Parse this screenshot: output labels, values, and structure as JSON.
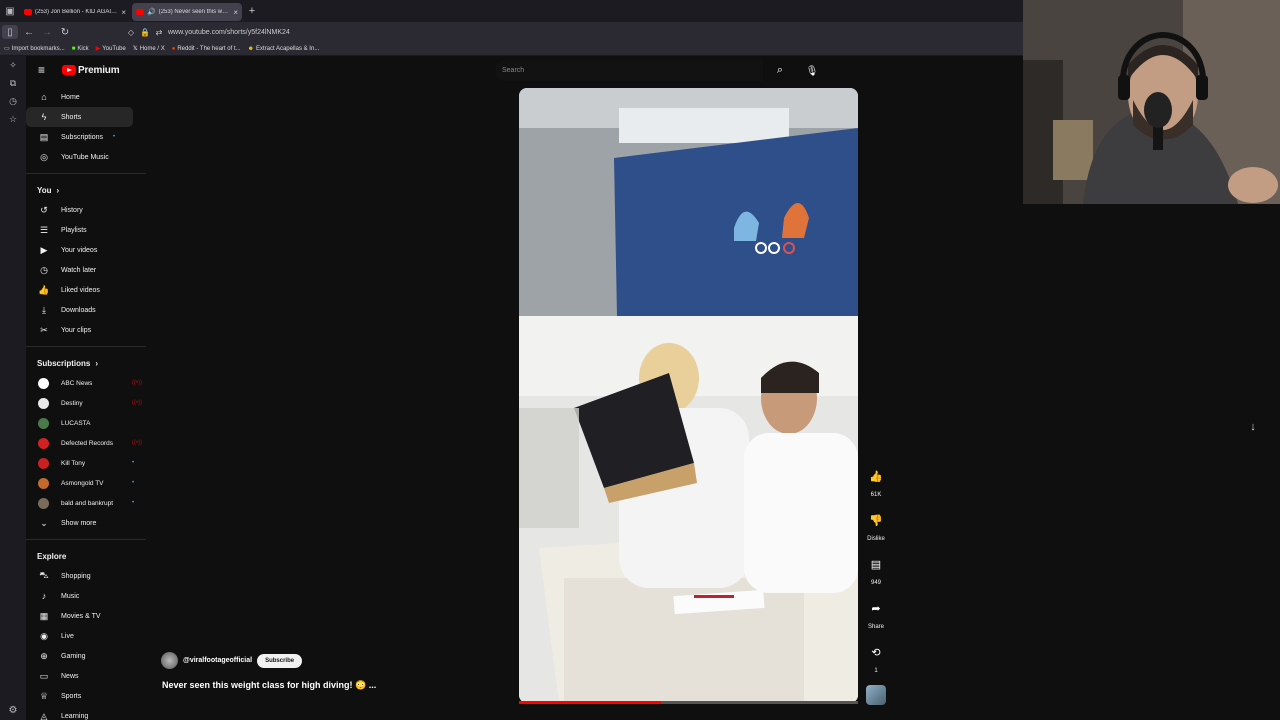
{
  "browser": {
    "tabs": [
      {
        "label": "(253) Jon Bellion - KID AGAIN (L",
        "active": false,
        "audio": false
      },
      {
        "label": "(253) Never seen this weigh",
        "active": true,
        "audio": true
      }
    ],
    "new_tab": "+",
    "url": "www.youtube.com/shorts/y5f24lNMK24",
    "bookmarks": [
      {
        "label": "Import bookmarks...",
        "icon": "folder-icon"
      },
      {
        "label": "Kick",
        "icon": "kick-icon"
      },
      {
        "label": "YouTube",
        "icon": "youtube-icon"
      },
      {
        "label": "Home / X",
        "icon": "x-icon"
      },
      {
        "label": "Reddit - The heart of t...",
        "icon": "reddit-icon"
      },
      {
        "label": "Extract Acapellas & In...",
        "icon": "app-icon"
      }
    ]
  },
  "youtube": {
    "logo_text": "Premium",
    "search_placeholder": "Search",
    "nav_main": [
      {
        "label": "Home",
        "icon": "home-icon",
        "glyph": "⌂"
      },
      {
        "label": "Shorts",
        "icon": "shorts-icon",
        "glyph": "ϟ",
        "active": true
      },
      {
        "label": "Subscriptions",
        "icon": "subscriptions-icon",
        "glyph": "▤",
        "dot": true
      },
      {
        "label": "YouTube Music",
        "icon": "music-circle-icon",
        "glyph": "◎"
      }
    ],
    "you_header": "You",
    "nav_you": [
      {
        "label": "History",
        "icon": "history-icon",
        "glyph": "↺"
      },
      {
        "label": "Playlists",
        "icon": "playlists-icon",
        "glyph": "☰"
      },
      {
        "label": "Your videos",
        "icon": "your-videos-icon",
        "glyph": "▶"
      },
      {
        "label": "Watch later",
        "icon": "watch-later-icon",
        "glyph": "◷"
      },
      {
        "label": "Liked videos",
        "icon": "like-icon",
        "glyph": "👍"
      },
      {
        "label": "Downloads",
        "icon": "download-icon",
        "glyph": "⤓"
      },
      {
        "label": "Your clips",
        "icon": "scissors-icon",
        "glyph": "✂"
      }
    ],
    "subscriptions_header": "Subscriptions",
    "subscriptions": [
      {
        "label": "ABC News",
        "color": "#ffffff",
        "text": "abc",
        "status": "live"
      },
      {
        "label": "Destiny",
        "color": "#e8e8e8",
        "text": "D",
        "status": "live"
      },
      {
        "label": "LUCASTA",
        "color": "#4a7a4a",
        "text": "",
        "status": "none"
      },
      {
        "label": "Defected Records",
        "color": "#d42020",
        "text": "",
        "status": "live"
      },
      {
        "label": "Kill Tony",
        "color": "#cc1f1f",
        "text": "K",
        "status": "dot"
      },
      {
        "label": "Asmongold TV",
        "color": "#c46a2a",
        "text": "",
        "status": "dot"
      },
      {
        "label": "bald and bankrupt",
        "color": "#7a6a5a",
        "text": "",
        "status": "dot"
      }
    ],
    "show_more": "Show more",
    "explore_header": "Explore",
    "nav_explore": [
      {
        "label": "Shopping",
        "icon": "shopping-bag-icon",
        "glyph": "⛍"
      },
      {
        "label": "Music",
        "icon": "music-note-icon",
        "glyph": "♪"
      },
      {
        "label": "Movies & TV",
        "icon": "movies-icon",
        "glyph": "▦"
      },
      {
        "label": "Live",
        "icon": "live-icon",
        "glyph": "◉"
      },
      {
        "label": "Gaming",
        "icon": "gaming-icon",
        "glyph": "⊕"
      },
      {
        "label": "News",
        "icon": "news-icon",
        "glyph": "▭"
      },
      {
        "label": "Sports",
        "icon": "trophy-icon",
        "glyph": "♕"
      },
      {
        "label": "Learning",
        "icon": "learning-icon",
        "glyph": "◬"
      }
    ],
    "short": {
      "channel": "@viralfootageofficial",
      "subscribe": "Subscribe",
      "title": "Never seen this weight class for high diving! 😳 ...",
      "progress": 0.42,
      "likes": "61K",
      "dislike": "Dislike",
      "comments": "949",
      "share": "Share",
      "remix": "1"
    }
  },
  "colors": {
    "brand_red": "#ff0000",
    "background": "#0f0f0f",
    "live_red": "#cc0000",
    "new_dot": "#3ea6ff"
  }
}
